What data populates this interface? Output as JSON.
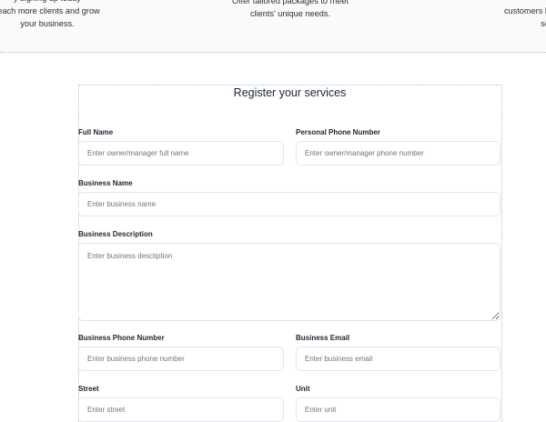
{
  "features": {
    "left_text": "...by signing up today\nreach more clients and grow\nyour business.",
    "center_text": "Offer tailored packages to meet\nclients' unique needs.",
    "right_text": "...customers looking\nservices"
  },
  "form": {
    "title": "Register your services",
    "fields": {
      "full_name": {
        "label": "Full Name",
        "placeholder": "Enter owner/manager full name"
      },
      "personal_phone": {
        "label": "Personal Phone Number",
        "placeholder": "Enter owner/manager phone number"
      },
      "business_name": {
        "label": "Business Name",
        "placeholder": "Enter business name"
      },
      "business_description": {
        "label": "Business Description",
        "placeholder": "Enter business desctiption"
      },
      "business_phone": {
        "label": "Business Phone Number",
        "placeholder": "Enter business phone number"
      },
      "business_email": {
        "label": "Business Email",
        "placeholder": "Enter business email"
      },
      "street": {
        "label": "Street",
        "placeholder": "Enter street"
      },
      "unit": {
        "label": "Unit",
        "placeholder": "Enter unit"
      }
    }
  }
}
